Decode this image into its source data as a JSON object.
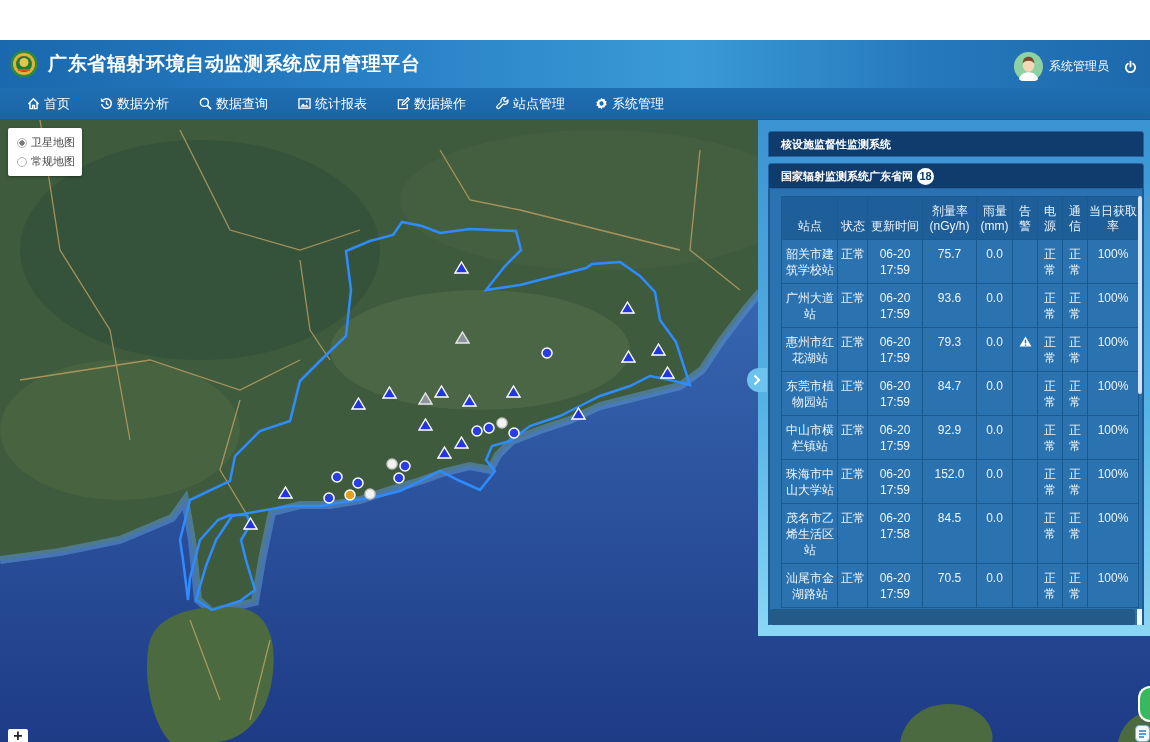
{
  "header": {
    "title": "广东省辐射环境自动监测系统应用管理平台",
    "user": "系统管理员"
  },
  "nav": [
    "首页",
    "数据分析",
    "数据查询",
    "统计报表",
    "数据操作",
    "站点管理",
    "系统管理"
  ],
  "map": {
    "layers": [
      {
        "label": "卫星地图",
        "selected": true
      },
      {
        "label": "常规地图",
        "selected": false
      }
    ],
    "zoom_in": "+"
  },
  "panel": {
    "sections": [
      {
        "title": "核设施监督性监测系统"
      },
      {
        "title": "国家辐射监测系统广东省网",
        "count": "18",
        "table": {
          "columns": [
            "站点",
            "状态",
            "更新时间",
            "剂量率(nGy/h)",
            "雨量(mm)",
            "告警",
            "电源",
            "通信",
            "当日获取率"
          ],
          "rows": [
            {
              "station": "韶关市建筑学校站",
              "status": "正常",
              "updated": "06-20 17:59",
              "dose_rate": "75.7",
              "rainfall": "0.0",
              "alarm": false,
              "power": "正常",
              "comms": "正常",
              "acquisition_rate": "100%"
            },
            {
              "station": "广州大道站",
              "status": "正常",
              "updated": "06-20 17:59",
              "dose_rate": "93.6",
              "rainfall": "0.0",
              "alarm": false,
              "power": "正常",
              "comms": "正常",
              "acquisition_rate": "100%"
            },
            {
              "station": "惠州市红花湖站",
              "status": "正常",
              "updated": "06-20 17:59",
              "dose_rate": "79.3",
              "rainfall": "0.0",
              "alarm": true,
              "power": "正常",
              "comms": "正常",
              "acquisition_rate": "100%"
            },
            {
              "station": "东莞市植物园站",
              "status": "正常",
              "updated": "06-20 17:59",
              "dose_rate": "84.7",
              "rainfall": "0.0",
              "alarm": false,
              "power": "正常",
              "comms": "正常",
              "acquisition_rate": "100%"
            },
            {
              "station": "中山市横栏镇站",
              "status": "正常",
              "updated": "06-20 17:59",
              "dose_rate": "92.9",
              "rainfall": "0.0",
              "alarm": false,
              "power": "正常",
              "comms": "正常",
              "acquisition_rate": "100%"
            },
            {
              "station": "珠海市中山大学站",
              "status": "正常",
              "updated": "06-20 17:59",
              "dose_rate": "152.0",
              "rainfall": "0.0",
              "alarm": false,
              "power": "正常",
              "comms": "正常",
              "acquisition_rate": "100%"
            },
            {
              "station": "茂名市乙烯生活区站",
              "status": "正常",
              "updated": "06-20 17:58",
              "dose_rate": "84.5",
              "rainfall": "0.0",
              "alarm": false,
              "power": "正常",
              "comms": "正常",
              "acquisition_rate": "100%"
            },
            {
              "station": "汕尾市金湖路站",
              "status": "正常",
              "updated": "06-20 17:59",
              "dose_rate": "70.5",
              "rainfall": "0.0",
              "alarm": false,
              "power": "正常",
              "comms": "正常",
              "acquisition_rate": "100%"
            }
          ]
        }
      }
    ]
  }
}
